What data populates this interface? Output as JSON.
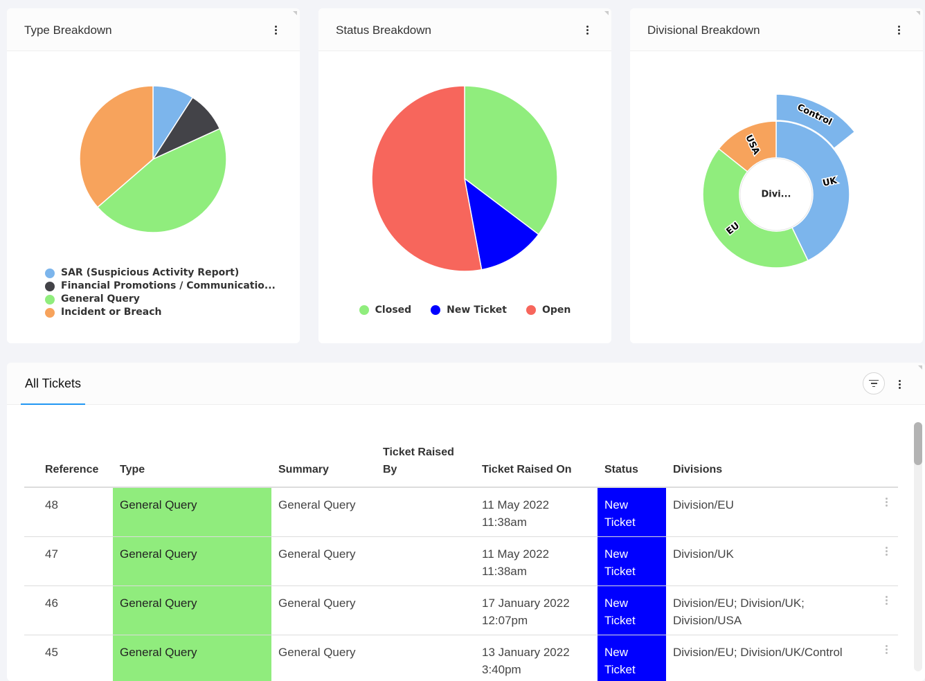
{
  "widgets": {
    "type_breakdown": {
      "title": "Type Breakdown"
    },
    "status_breakdown": {
      "title": "Status Breakdown"
    },
    "divisional_breakdown": {
      "title": "Divisional Breakdown"
    }
  },
  "chart_data": [
    {
      "type": "pie",
      "title": "Type Breakdown",
      "categories": [
        "SAR (Suspicious Activity Report)",
        "Financial Promotions / Communicatio...",
        "General Query",
        "Incident or Breach"
      ],
      "values": [
        1,
        1,
        5,
        4
      ],
      "colors": [
        "#7cb5ec",
        "#434348",
        "#90ed7d",
        "#f7a35c"
      ],
      "legend": "bottom-left"
    },
    {
      "type": "pie",
      "title": "Status Breakdown",
      "categories": [
        "Closed",
        "New Ticket",
        "Open"
      ],
      "values": [
        6,
        2,
        9
      ],
      "colors": [
        "#90ed7d",
        "#0000ff",
        "#f7665c"
      ],
      "legend": "bottom"
    },
    {
      "type": "sunburst",
      "title": "Divisional Breakdown",
      "center_label": "Divi...",
      "series": [
        {
          "name": "UK",
          "value": 3,
          "color": "#7cb5ec",
          "children": [
            {
              "name": "Control",
              "value": 1,
              "color": "#7cb5ec"
            }
          ]
        },
        {
          "name": "EU",
          "value": 3,
          "color": "#90ed7d",
          "children": []
        },
        {
          "name": "USA",
          "value": 1,
          "color": "#f7a35c",
          "children": []
        }
      ]
    }
  ],
  "tickets": {
    "tab_label": "All Tickets",
    "columns": [
      "Reference",
      "Type",
      "Summary",
      "Ticket Raised By",
      "Ticket Raised On",
      "Status",
      "Divisions"
    ],
    "rows": [
      {
        "reference": "48",
        "type": "General Query",
        "summary": "General Query",
        "raised_by": "",
        "raised_on_date": "11 May 2022",
        "raised_on_time": "11:38am",
        "status_l1": "New",
        "status_l2": "Ticket",
        "divisions": "Division/EU"
      },
      {
        "reference": "47",
        "type": "General Query",
        "summary": "General Query",
        "raised_by": "",
        "raised_on_date": "11 May 2022",
        "raised_on_time": "11:38am",
        "status_l1": "New",
        "status_l2": "Ticket",
        "divisions": "Division/UK"
      },
      {
        "reference": "46",
        "type": "General Query",
        "summary": "General Query",
        "raised_by": "",
        "raised_on_date": "17 January 2022",
        "raised_on_time": "12:07pm",
        "status_l1": "New",
        "status_l2": "Ticket",
        "divisions": "Division/EU; Division/UK; Division/USA"
      },
      {
        "reference": "45",
        "type": "General Query",
        "summary": "General Query",
        "raised_by": "",
        "raised_on_date": "13 January 2022",
        "raised_on_time": "3:40pm",
        "status_l1": "New",
        "status_l2": "Ticket",
        "divisions": "Division/EU; Division/UK/Control"
      }
    ]
  },
  "colors": {
    "accent": "#2196f3",
    "type_general_query": "#90ec7d",
    "status_new_ticket": "#0000ff"
  }
}
